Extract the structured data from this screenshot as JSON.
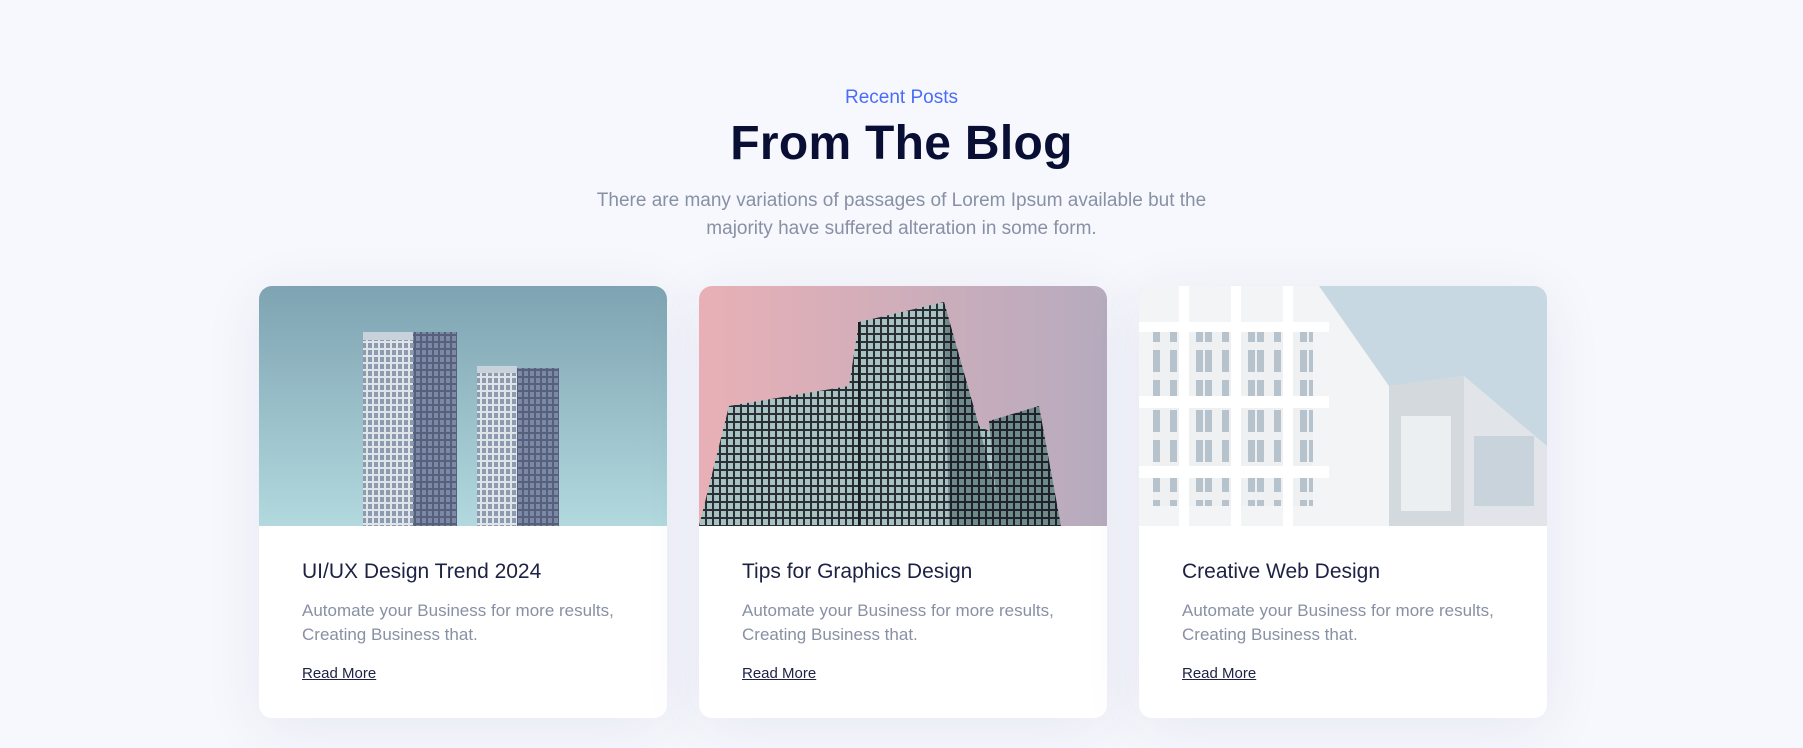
{
  "section": {
    "eyebrow": "Recent Posts",
    "title": "From The Blog",
    "subtitle": "There are many variations of passages of Lorem Ipsum available but the majority have suffered alteration in some form."
  },
  "posts": [
    {
      "title": "UI/UX Design Trend 2024",
      "description": "Automate your Business for more results, Creating Business that.",
      "link_label": "Read More",
      "image": "twin-skyscrapers-image"
    },
    {
      "title": "Tips for Graphics Design",
      "description": "Automate your Business for more results, Creating Business that.",
      "link_label": "Read More",
      "image": "glass-office-tower-image"
    },
    {
      "title": "Creative Web Design",
      "description": "Automate your Business for more results, Creating Business that.",
      "link_label": "Read More",
      "image": "white-modern-building-image"
    }
  ],
  "colors": {
    "accent": "#4a6cf7",
    "heading": "#090e34",
    "body_text": "#8890a4",
    "background": "#f7f8fd"
  }
}
